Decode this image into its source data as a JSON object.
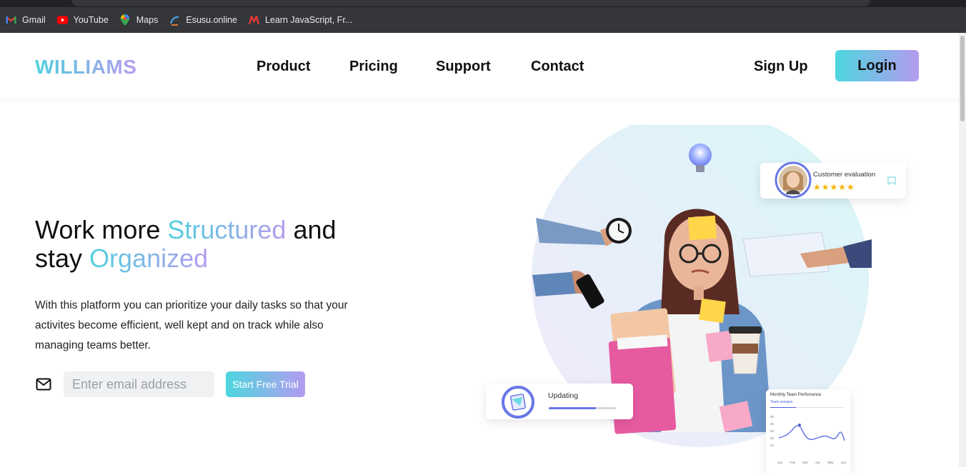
{
  "bookmarks": [
    {
      "label": "Gmail",
      "icon": "gmail-icon"
    },
    {
      "label": "YouTube",
      "icon": "youtube-icon"
    },
    {
      "label": "Maps",
      "icon": "maps-icon"
    },
    {
      "label": "Esusu.online",
      "icon": "esusu-icon"
    },
    {
      "label": "Learn JavaScript, Fr...",
      "icon": "learn-icon"
    }
  ],
  "nav": {
    "logo": "WILLIAMS",
    "links": [
      "Product",
      "Pricing",
      "Support",
      "Contact"
    ],
    "signup": "Sign Up",
    "login": "Login"
  },
  "hero": {
    "title_part1": "Work more ",
    "title_highlight1": "Structured",
    "title_part2": " and",
    "title_part3": "stay ",
    "title_highlight2": "Organized",
    "description": "With this platform you can prioritize your daily tasks so that your activites become efficient, well kept and on track while also managing teams better.",
    "email_placeholder": "Enter email address",
    "cta": "Start Free Trial"
  },
  "illustration": {
    "customer_card": {
      "label": "Customer evaluation",
      "stars": "★★★★★"
    },
    "updating_card": {
      "label": "Updating",
      "progress": 0.7
    },
    "team_card": {
      "title": "Monthly Team Perfomance",
      "tab": "Team averges",
      "yticks": [
        "30",
        "25",
        "20",
        "15",
        "10"
      ],
      "months": [
        "Jan",
        "Feb",
        "Mar",
        "Apr",
        "May",
        "Jun"
      ]
    }
  },
  "colors": {
    "accent_start": "#4dd6de",
    "accent_end": "#b49bf0",
    "bookmark_bar": "#35363a"
  }
}
